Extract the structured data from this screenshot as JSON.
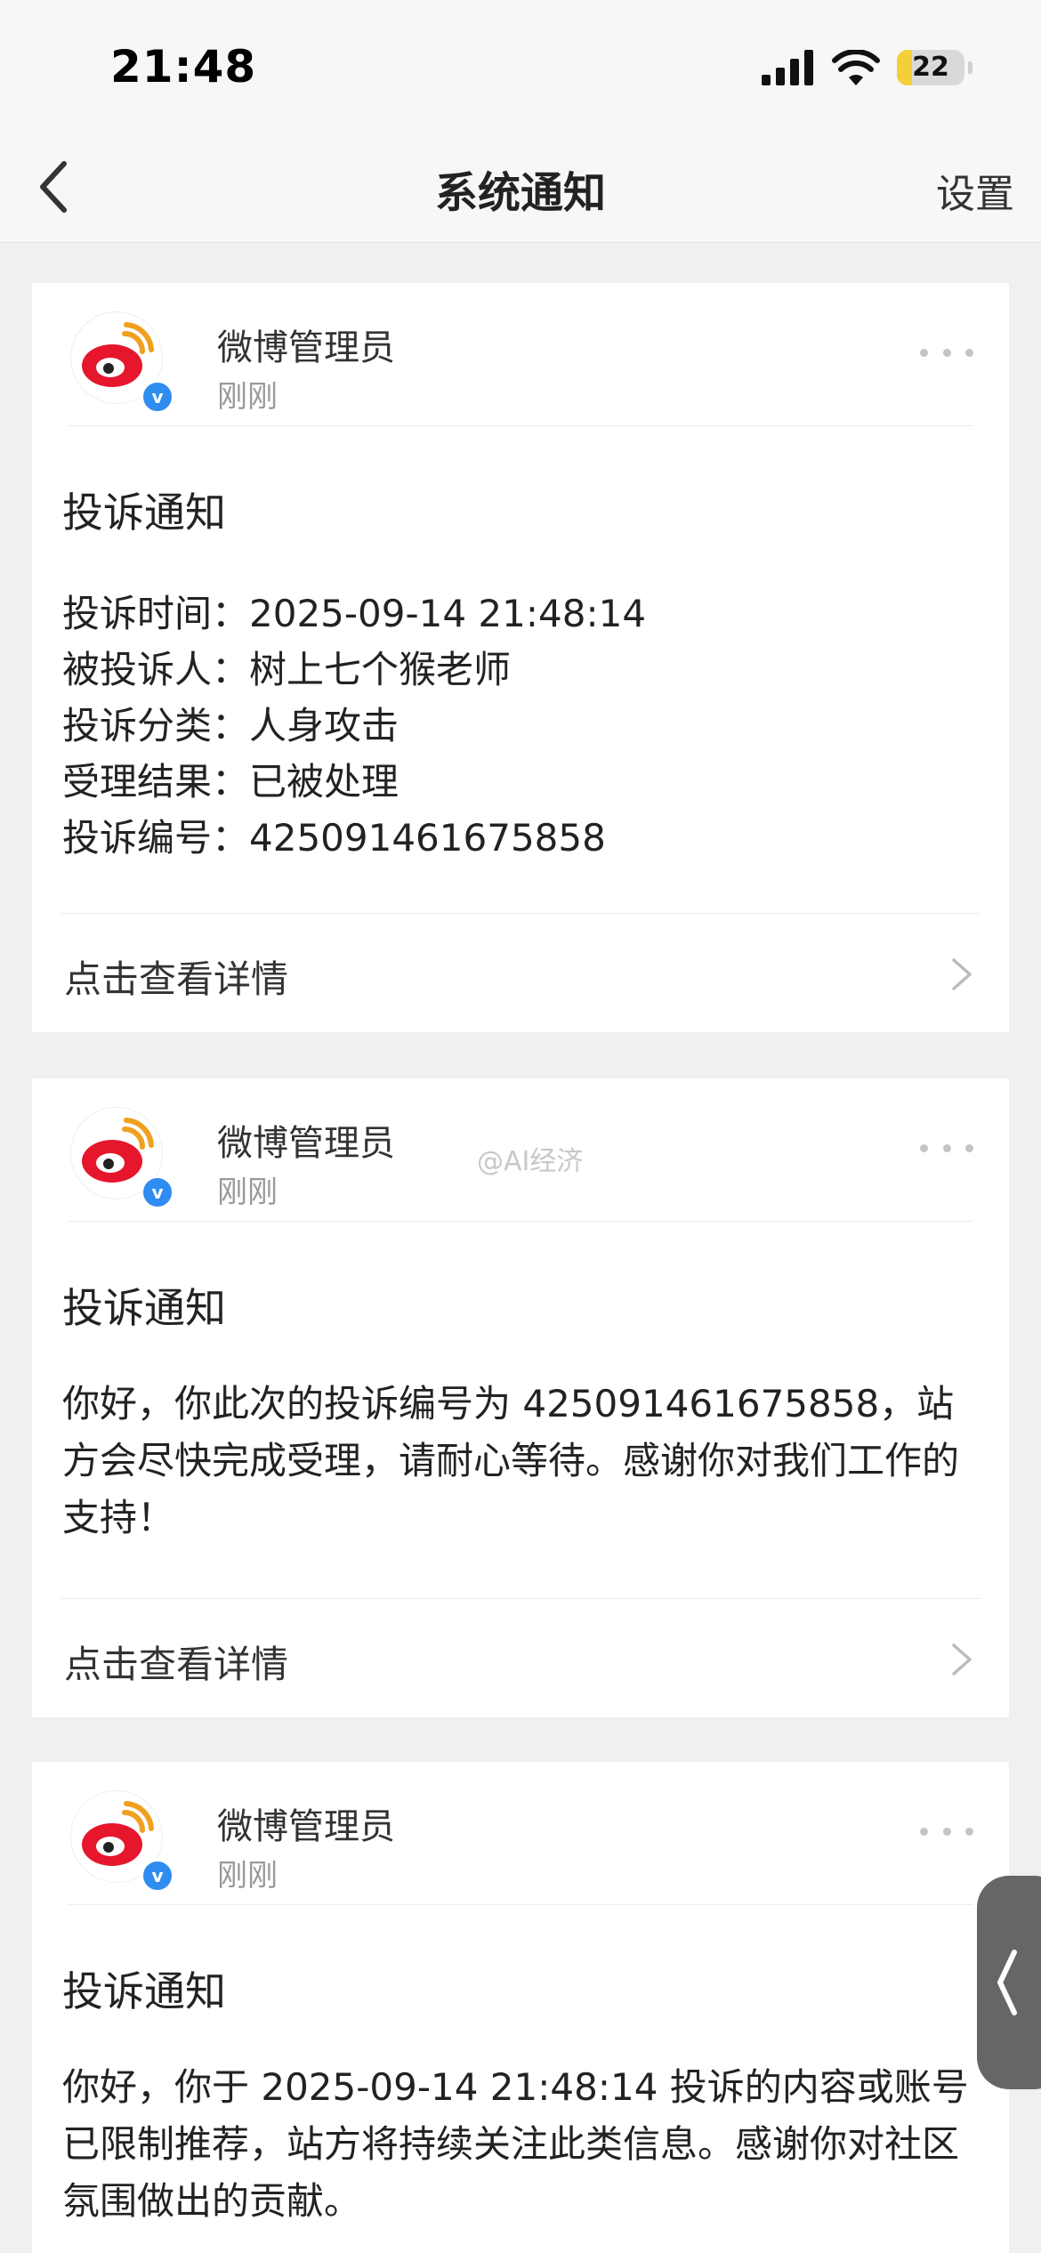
{
  "status_bar": {
    "time": "21:48",
    "battery_level": "22",
    "battery_fraction": 0.22
  },
  "nav": {
    "title": "系统通知",
    "settings_label": "设置",
    "back_icon": "chevron-left-icon"
  },
  "colors": {
    "weibo_red": "#e6162d",
    "weibo_orange": "#f0a020",
    "verified_blue": "#2f8cf0",
    "battery_yellow": "#f5cf3a"
  },
  "notifications": [
    {
      "sender": "微博管理员",
      "time": "刚刚",
      "title": "投诉通知",
      "details": [
        "投诉时间：2025-09-14 21:48:14",
        "被投诉人：树上七个猴老师",
        "投诉分类：人身攻击",
        "受理结果：已被处理",
        "投诉编号：425091461675858"
      ],
      "footer_label": "点击查看详情"
    },
    {
      "sender": "微博管理员",
      "time": "刚刚",
      "watermark": "@AI经济",
      "title": "投诉通知",
      "body": "你好，你此次的投诉编号为 425091461675858，站方会尽快完成受理，请耐心等待。感谢你对我们工作的支持！",
      "footer_label": "点击查看详情"
    },
    {
      "sender": "微博管理员",
      "time": "刚刚",
      "title": "投诉通知",
      "body": "你好，你于 2025-09-14 21:48:14 投诉的内容或账号已限制推荐，站方将持续关注此类信息。感谢你对社区氛围做出的贡献。"
    }
  ]
}
